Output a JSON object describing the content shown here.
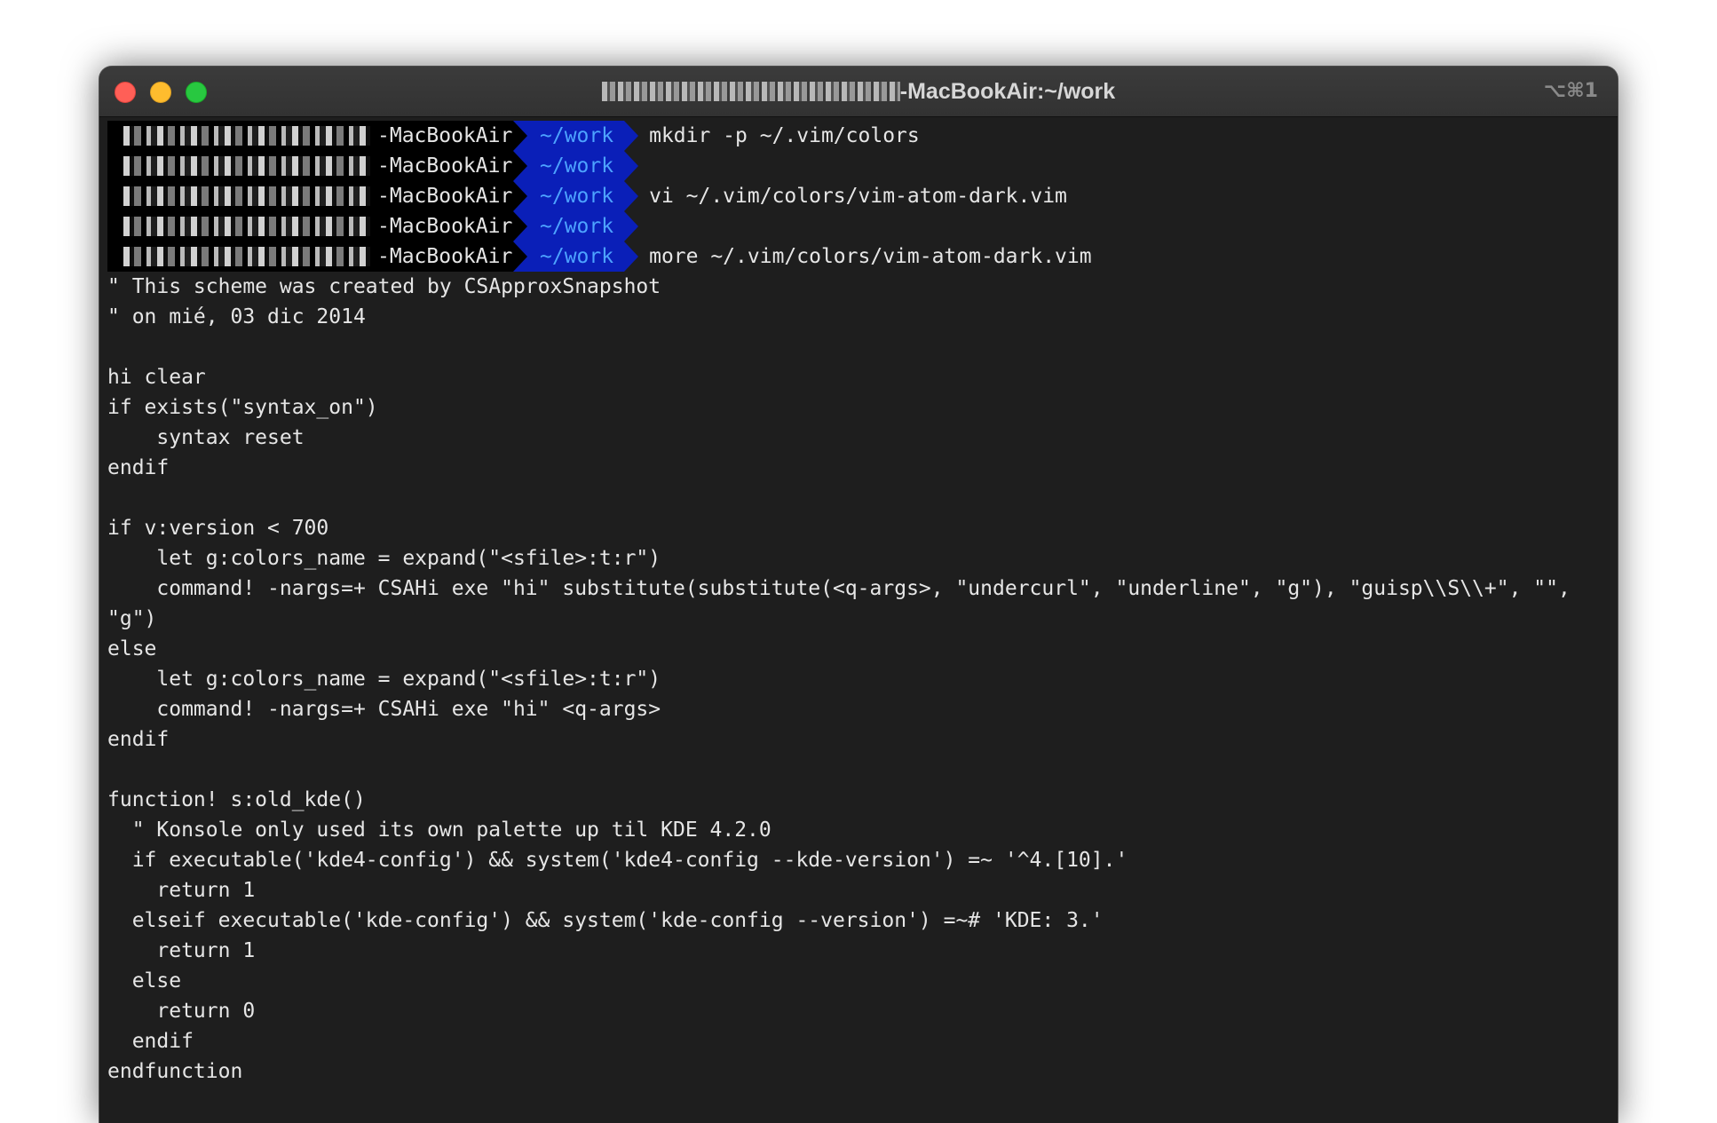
{
  "window": {
    "title_suffix": "-MacBookAir:~/work",
    "shortcut": "⌥⌘1"
  },
  "prompts": [
    {
      "host": "-MacBookAir",
      "dir": "~/work",
      "command": "mkdir -p ~/.vim/colors"
    },
    {
      "host": "-MacBookAir",
      "dir": "~/work",
      "command": ""
    },
    {
      "host": "-MacBookAir",
      "dir": "~/work",
      "command": "vi ~/.vim/colors/vim-atom-dark.vim"
    },
    {
      "host": "-MacBookAir",
      "dir": "~/work",
      "command": ""
    },
    {
      "host": "-MacBookAir",
      "dir": "~/work",
      "command": "more ~/.vim/colors/vim-atom-dark.vim"
    }
  ],
  "output_lines": [
    "\" This scheme was created by CSApproxSnapshot",
    "\" on mié, 03 dic 2014",
    "",
    "hi clear",
    "if exists(\"syntax_on\")",
    "    syntax reset",
    "endif",
    "",
    "if v:version < 700",
    "    let g:colors_name = expand(\"<sfile>:t:r\")",
    "    command! -nargs=+ CSAHi exe \"hi\" substitute(substitute(<q-args>, \"undercurl\", \"underline\", \"g\"), \"guisp\\\\S\\\\+\", \"\",",
    "\"g\")",
    "else",
    "    let g:colors_name = expand(\"<sfile>:t:r\")",
    "    command! -nargs=+ CSAHi exe \"hi\" <q-args>",
    "endif",
    "",
    "function! s:old_kde()",
    "  \" Konsole only used its own palette up til KDE 4.2.0",
    "  if executable('kde4-config') && system('kde4-config --kde-version') =~ '^4.[10].'",
    "    return 1",
    "  elseif executable('kde-config') && system('kde-config --version') =~# 'KDE: 3.'",
    "    return 1",
    "  else",
    "    return 0",
    "  endif",
    "endfunction"
  ]
}
